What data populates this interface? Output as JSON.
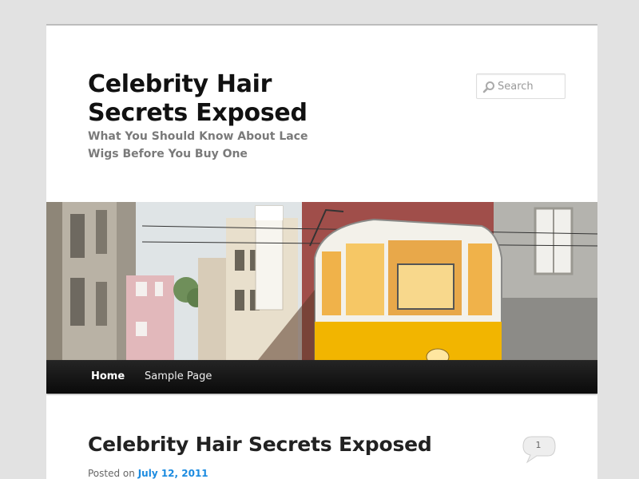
{
  "site": {
    "title": "Celebrity Hair Secrets Exposed",
    "description": "What You Should Know About Lace Wigs Before You Buy One"
  },
  "search": {
    "placeholder": "Search"
  },
  "nav": {
    "items": [
      {
        "label": "Home",
        "current": true
      },
      {
        "label": "Sample Page",
        "current": false
      }
    ]
  },
  "post": {
    "title": "Celebrity Hair Secrets Exposed",
    "posted_on_label": "Posted on",
    "date": "July 12, 2011",
    "comment_count": "1"
  },
  "header_image": {
    "subject": "yellow-tram-street"
  },
  "colors": {
    "link": "#1b8be0",
    "nav_bg": "#111111",
    "tram_yellow": "#f2b500"
  }
}
